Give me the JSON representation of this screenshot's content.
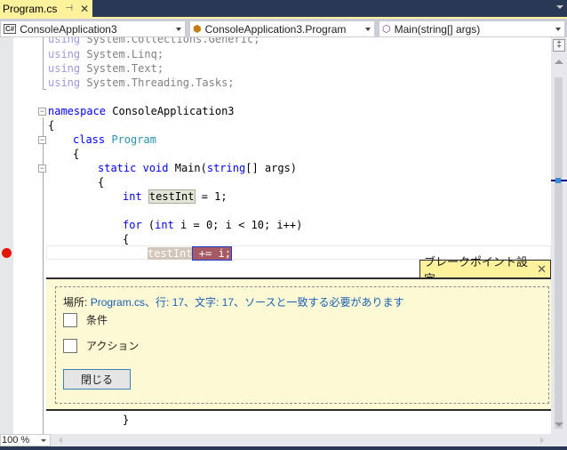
{
  "tab": {
    "title": "Program.cs",
    "pin_icon": "pin-icon",
    "close_icon": "close-icon"
  },
  "navbar": {
    "project": "ConsoleApplication3",
    "project_icon": "C#",
    "class": "ConsoleApplication3.Program",
    "member": "Main(string[] args)"
  },
  "code": {
    "using1_kw": "using",
    "using1_tx": " System.Collections.Generic;",
    "using2_kw": "using",
    "using2_tx": " System.Linq;",
    "using3_kw": "using",
    "using3_tx": " System.Text;",
    "using4_kw": "using",
    "using4_tx": " System.Threading.Tasks;",
    "ns_kw": "namespace",
    "ns_name": " ConsoleApplication3",
    "brace_open": "{",
    "brace_close": "}",
    "class_kw": "class",
    "class_name": "Program",
    "static_kw": "static",
    "void_kw": "void",
    "main_sig": " Main(",
    "string_kw": "string",
    "main_args": "[] args)",
    "int_kw": "int",
    "test_var": "testInt",
    "assign_rest": " = 1;",
    "for_kw": "for",
    "for_open": " (",
    "for_rest": " i = 0; i < 10; i++)",
    "bp_part1": "testInt",
    "bp_part2": " += i;"
  },
  "breakpoint_settings": {
    "tab_title": "ブレークポイント設定",
    "location_label": "場所:",
    "location_value": "Program.cs、行: 17、文字: 17、ソースと一致する必要があります",
    "condition_label": "条件",
    "condition_checked": false,
    "action_label": "アクション",
    "action_checked": false,
    "close_button": "閉じる"
  },
  "status": {
    "zoom_level": "100 %"
  },
  "colors": {
    "accent_tab": "#fff29d",
    "breakpoint": "#e51400",
    "peek_background": "#fdf9d4",
    "keyword": "#0000ff",
    "type": "#2b91af"
  }
}
